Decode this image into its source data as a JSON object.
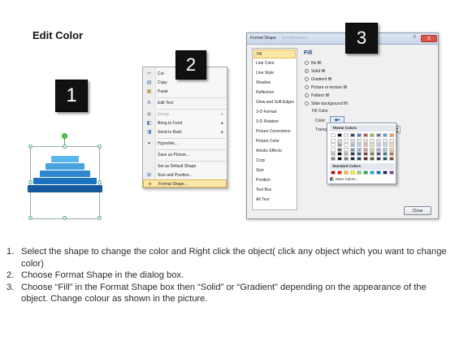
{
  "title": "Edit Color",
  "steps": [
    "1",
    "2",
    "3"
  ],
  "context_menu": {
    "items": [
      {
        "icon": "scissors-icon",
        "glyph": "✂",
        "label": "Cut",
        "arrow": false
      },
      {
        "icon": "copy-icon",
        "glyph": "▤",
        "label": "Copy",
        "arrow": false
      },
      {
        "icon": "paste-icon",
        "glyph": "▦",
        "label": "Paste",
        "arrow": false
      },
      {
        "icon": "edit-text-icon",
        "glyph": "A",
        "label": "Edit Text",
        "arrow": false
      },
      {
        "icon": "group-icon",
        "glyph": "▣",
        "label": "Group",
        "arrow": true
      },
      {
        "icon": "bring-to-front-icon",
        "glyph": "◧",
        "label": "Bring to Front",
        "arrow": true
      },
      {
        "icon": "send-to-back-icon",
        "glyph": "◨",
        "label": "Send to Back",
        "arrow": true
      },
      {
        "icon": "hyperlink-icon",
        "glyph": "⚭",
        "label": "Hyperlink...",
        "arrow": false
      },
      {
        "icon": "",
        "glyph": "",
        "label": "Save as Picture...",
        "arrow": false
      },
      {
        "icon": "",
        "glyph": "",
        "label": "Set as Default Shape",
        "arrow": false
      },
      {
        "icon": "size-position-icon",
        "glyph": "⊞",
        "label": "Size and Position...",
        "arrow": false
      },
      {
        "icon": "format-shape-icon",
        "glyph": "◈",
        "label": "Format Shape...",
        "arrow": false
      }
    ]
  },
  "dialog": {
    "title": "Format Shape",
    "ghost_title": "Text Animation",
    "help": "?",
    "close": "X",
    "categories": [
      "Fill",
      "Line Color",
      "Line Style",
      "Shadow",
      "Reflection",
      "Glow and Soft Edges",
      "3-D Format",
      "3-D Rotation",
      "Picture Corrections",
      "Picture Color",
      "Artistic Effects",
      "Crop",
      "Size",
      "Position",
      "Text Box",
      "Alt Text"
    ],
    "selected_category": "Fill",
    "panel_heading": "Fill",
    "fill_options": [
      {
        "label": "No fill",
        "checked": false
      },
      {
        "label": "Solid fill",
        "checked": true
      },
      {
        "label": "Gradient fill",
        "checked": false
      },
      {
        "label": "Picture or texture fill",
        "checked": false
      },
      {
        "label": "Pattern fill",
        "checked": false
      },
      {
        "label": "Slide background fill",
        "checked": false
      }
    ],
    "fill_color_heading": "Fill Color",
    "color_label": "Color:",
    "transparency_label": "Transpa",
    "close_button": "Close"
  },
  "palette": {
    "theme_heading": "Theme Colors",
    "standard_heading": "Standard Colors",
    "more_colors": "More Colors...",
    "theme_top": [
      "#ffffff",
      "#000000",
      "#eeece1",
      "#1f497d",
      "#4f81bd",
      "#c0504d",
      "#9bbb59",
      "#8064a2",
      "#4bacc6",
      "#f79646"
    ],
    "standard": [
      "#c00000",
      "#ff0000",
      "#ffc000",
      "#ffff00",
      "#92d050",
      "#00b050",
      "#00b0f0",
      "#0070c0",
      "#002060",
      "#7030a0"
    ]
  },
  "instructions": [
    "Select the shape to change the color and Right click the object( click any object which you want to change color)",
    "Choose Format Shape in the dialog box.",
    "Choose “Fill” in the Format Shape box then “Solid” or “Gradient” depending on the appearance of the object. Change colour as shown in the picture."
  ]
}
